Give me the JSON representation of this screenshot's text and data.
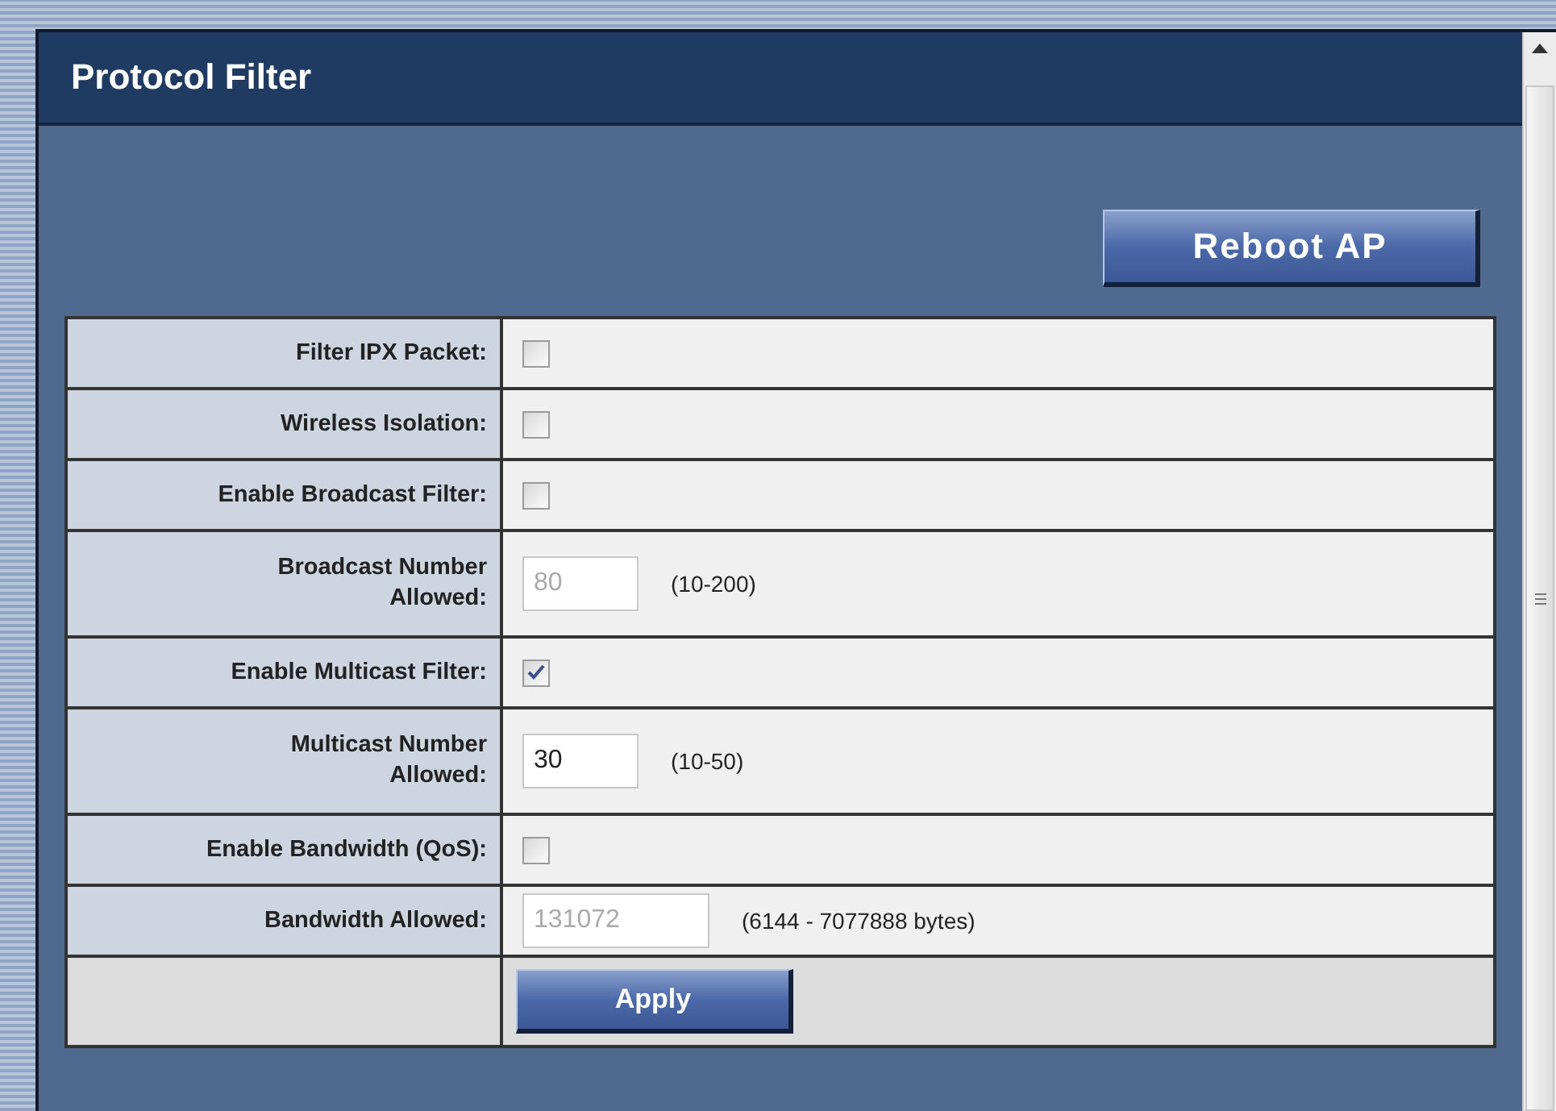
{
  "panel": {
    "title": "Protocol Filter"
  },
  "reboot_button": "Reboot AP",
  "rows": [
    {
      "kind": "checkbox",
      "label_lines": [
        "Filter IPX Packet:"
      ],
      "checked": false
    },
    {
      "kind": "checkbox",
      "label_lines": [
        "Wireless Isolation:"
      ],
      "checked": false
    },
    {
      "kind": "checkbox",
      "label_lines": [
        "Enable Broadcast Filter:"
      ],
      "checked": false
    },
    {
      "kind": "number",
      "label_lines": [
        "Broadcast Number",
        "Allowed:"
      ],
      "value": "80",
      "disabled": true,
      "range": "(10-200)"
    },
    {
      "kind": "checkbox",
      "label_lines": [
        "Enable Multicast Filter:"
      ],
      "checked": true
    },
    {
      "kind": "number",
      "label_lines": [
        "Multicast Number",
        "Allowed:"
      ],
      "value": "30",
      "disabled": false,
      "range": "(10-50)"
    },
    {
      "kind": "checkbox",
      "label_lines": [
        "Enable Bandwidth (QoS):"
      ],
      "checked": false
    },
    {
      "kind": "wide-number",
      "label_lines": [
        "Bandwidth Allowed:"
      ],
      "value": "131072",
      "disabled": true,
      "range": "(6144 - 7077888 bytes)"
    }
  ],
  "apply_button": "Apply"
}
